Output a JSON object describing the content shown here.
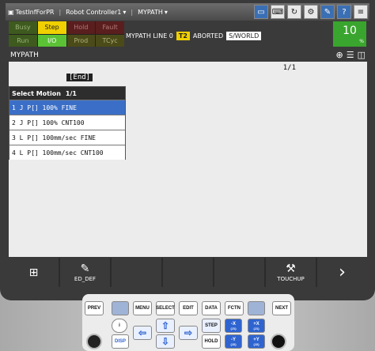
{
  "titlebar": {
    "program_name": "TestInfForPR",
    "controller": "Robot Controller1",
    "page": "MYPATH",
    "icons": [
      "monitor-icon",
      "keyboard-icon",
      "refresh-icon",
      "robot-icon",
      "edit-icon",
      "help-icon",
      "menu-icon"
    ]
  },
  "status": {
    "grid": [
      "Busy",
      "Step",
      "Hold",
      "Fault",
      "Run",
      "I/O",
      "Prod",
      "TCyc"
    ],
    "line_label": "MYPATH LINE 0",
    "t2": "T2",
    "aborted": "ABORTED",
    "frame": "S/WORLD",
    "override": "10",
    "override_unit": "%"
  },
  "header": {
    "title": "MYPATH",
    "icons": [
      "zoom-icon",
      "list-icon",
      "split-view-icon"
    ]
  },
  "content": {
    "end_label": "[End]",
    "page_count": "1/1",
    "motion_box": {
      "title": "Select Motion",
      "page": "1/1",
      "items": [
        "1 J P[] 100% FINE",
        "2 J P[] 100% CNT100",
        "3 L P[] 100mm/sec FINE",
        "4 L P[] 100mm/sec CNT100"
      ]
    }
  },
  "function_bar": {
    "keys": [
      {
        "label": "",
        "icon": "grid-icon"
      },
      {
        "label": "ED_DEF",
        "icon": "edit-define-icon"
      },
      {
        "label": "",
        "icon": ""
      },
      {
        "label": "",
        "icon": ""
      },
      {
        "label": "",
        "icon": ""
      },
      {
        "label": "TOUCHUP",
        "icon": "touchup-icon"
      },
      {
        "label": "",
        "icon": "chevron-right-icon"
      }
    ]
  },
  "keypad": {
    "prev": "PREV",
    "menu": "MENU",
    "select": "SELECT",
    "edit": "EDIT",
    "data": "DATA",
    "fctn": "FCTN",
    "next": "NEXT",
    "step": "STEP",
    "hold": "HOLD",
    "disp": "DISP",
    "neg_x": "-X",
    "neg_x_sub": "(J1)",
    "pos_x": "+X",
    "pos_x_sub": "(J1)",
    "neg_y": "-Y",
    "neg_y_sub": "(J2)",
    "pos_y": "+Y",
    "pos_y_sub": "(J2)"
  }
}
